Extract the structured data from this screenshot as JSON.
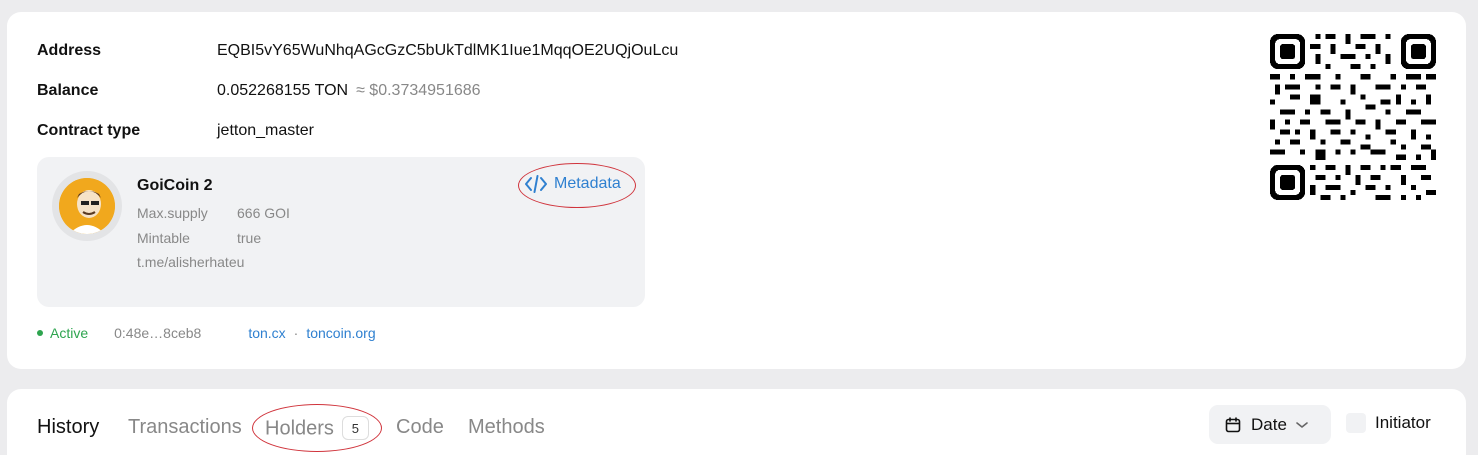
{
  "account": {
    "address_label": "Address",
    "address": "EQBI5vY65WuNhqAGcGzC5bUkTdlMK1Iue1MqqOE2UQjOuLcu",
    "balance_label": "Balance",
    "balance": "0.052268155 TON",
    "balance_usd": "≈ $0.3734951686",
    "contract_type_label": "Contract type",
    "contract_type": "jetton_master"
  },
  "token": {
    "name": "GoiCoin 2",
    "max_supply_label": "Max.supply",
    "max_supply": "666 GOI",
    "mintable_label": "Mintable",
    "mintable": "true",
    "link": "t.me/alisherhateu",
    "metadata_label": "Metadata"
  },
  "status": {
    "state": "Active",
    "hash": "0:48e…8ceb8",
    "link_1": "ton.cx",
    "separator": "·",
    "link_2": "toncoin.org"
  },
  "tabs": [
    {
      "label": "History"
    },
    {
      "label": "Transactions"
    },
    {
      "label": "Holders",
      "count": "5"
    },
    {
      "label": "Code"
    },
    {
      "label": "Methods"
    }
  ],
  "filters": {
    "date_label": "Date",
    "initiator_label": "Initiator"
  },
  "colors": {
    "accent": "#2f80d0",
    "active": "#2ea44f",
    "annotation": "#d0343c"
  }
}
